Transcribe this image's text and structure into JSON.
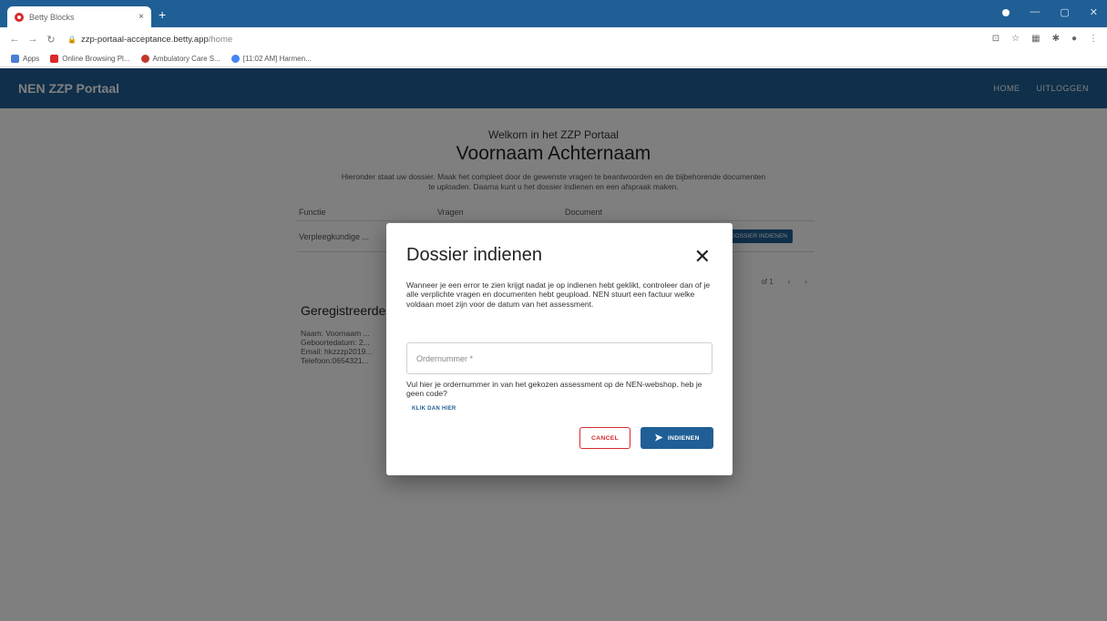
{
  "browser": {
    "tab_title": "Betty Blocks",
    "tab_close": "×",
    "new_tab": "+",
    "url_host": "zzp-portaal-acceptance.betty.app",
    "url_path": "/home",
    "bookmarks": [
      "Apps",
      "Online Browsing Pl...",
      "Ambulatory Care S...",
      "[11:02 AM] Harmen..."
    ]
  },
  "app": {
    "brand": "NEN ZZP Portaal",
    "nav": [
      "HOME",
      "UITLOGGEN"
    ],
    "welcome": "Welkom in het ZZP Portaal",
    "user_name": "Voornaam Achternaam",
    "intro": "Hieronder staat uw dossier. Maak het compleet door de gewenste vragen te beantwoorden en de bijbehorende documenten te uploaden. Daarna kunt u het dossier indienen en een afspraak maken.",
    "table": {
      "headers": [
        "Functie",
        "Vragen",
        "Document"
      ],
      "row_label": "Verpleegkundige ...",
      "row_action": "DOSSIER INDIENEN",
      "pager": [
        "of 1",
        "‹",
        "›"
      ]
    },
    "registered": {
      "title": "Geregistreerde gegevens",
      "lines": [
        "Naam: Voornaam ...",
        "Geboortedatum: 2...",
        "Email: hkzzzp2019...",
        "Telefoon:0654321..."
      ]
    }
  },
  "dialog": {
    "title": "Dossier indienen",
    "close": "✕",
    "message": "Wanneer je een error te zien krijgt nadat je op indienen hebt geklikt, controleer dan of je alle verplichte vragen en documenten hebt geupload. NEN stuurt een factuur welke voldaan moet zijn voor de datum van het assessment.",
    "order_placeholder": "Ordernummer *",
    "helper": "Vul hier je ordernummer in van het gekozen assessment op de NEN-webshop. heb je geen code?",
    "helper_link": "KLIK DAN HIER",
    "cancel": "CANCEL",
    "submit": "INDIENEN",
    "submit_arrow": "➤"
  }
}
